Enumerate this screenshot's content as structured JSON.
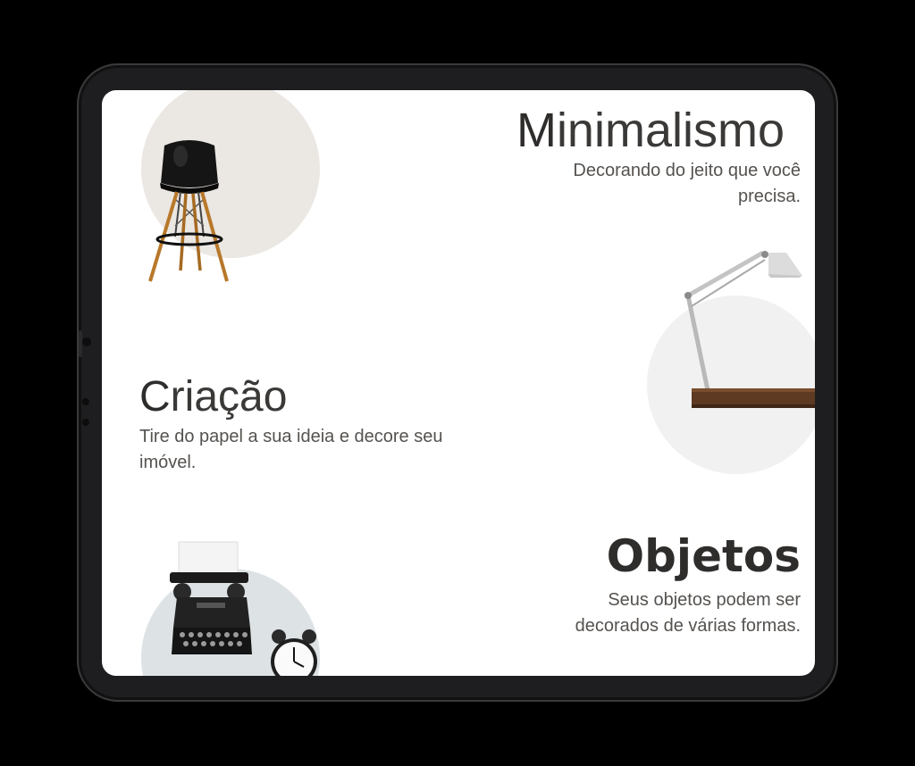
{
  "sections": [
    {
      "title_initial": "M",
      "title_rest": "inimalismo",
      "description": "Decorando do jeito que você precisa."
    },
    {
      "title_initial": "C",
      "title_rest": "riação",
      "description": "Tire do papel a sua ideia e decore seu imóvel."
    },
    {
      "title_initial": "",
      "title_rest": "Objetos",
      "description": "Seus objetos podem ser decorados de várias formas."
    }
  ],
  "colors": {
    "text": "#2f2d2c",
    "circle_beige": "#ebe7e3",
    "circle_gray": "#f1f1f1",
    "circle_blue": "#dde3e5"
  },
  "icons": [
    "chair-icon",
    "desk-lamp-icon",
    "typewriter-icon",
    "alarm-clock-icon"
  ]
}
